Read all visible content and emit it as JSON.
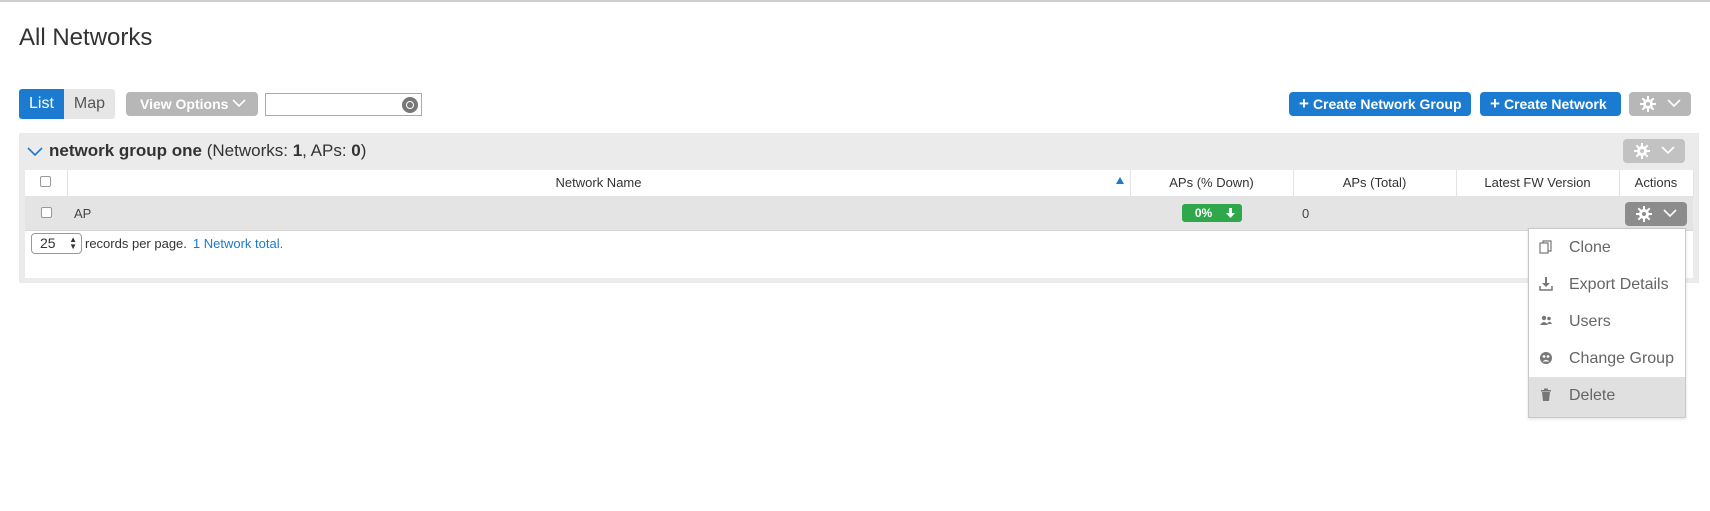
{
  "page": {
    "title": "All Networks"
  },
  "toolbar": {
    "list_label": "List",
    "map_label": "Map",
    "view_options_label": "View Options",
    "search": {
      "value": "",
      "placeholder": ""
    },
    "create_group_label": "Create Network Group",
    "create_network_label": "Create Network"
  },
  "group": {
    "name": "network group one",
    "meta_open": " (Networks: ",
    "networks_count": "1",
    "meta_mid": ", APs: ",
    "aps_count": "0",
    "meta_close": ")"
  },
  "table": {
    "columns": [
      "Network Name",
      "APs (% Down)",
      "APs (Total)",
      "Latest FW Version",
      "Actions"
    ],
    "sort": {
      "column": "Network Name",
      "direction": "ascending"
    },
    "rows": [
      {
        "name": "AP",
        "aps_down": "0%",
        "aps_total": "0",
        "fw_version": ""
      }
    ]
  },
  "footer": {
    "per_page": "25",
    "per_page_label": "records per page.",
    "total_label": "1 Network total."
  },
  "actions_menu": {
    "items": [
      {
        "label": "Clone",
        "icon": "clone-icon"
      },
      {
        "label": "Export Details",
        "icon": "download-icon"
      },
      {
        "label": "Users",
        "icon": "users-icon"
      },
      {
        "label": "Change Group",
        "icon": "change-group-icon"
      },
      {
        "label": "Delete",
        "icon": "trash-icon",
        "highlighted": true
      }
    ]
  },
  "colors": {
    "accent": "#1a7bd0",
    "success": "#2ea84a",
    "gray_button": "#b7b7b7"
  }
}
